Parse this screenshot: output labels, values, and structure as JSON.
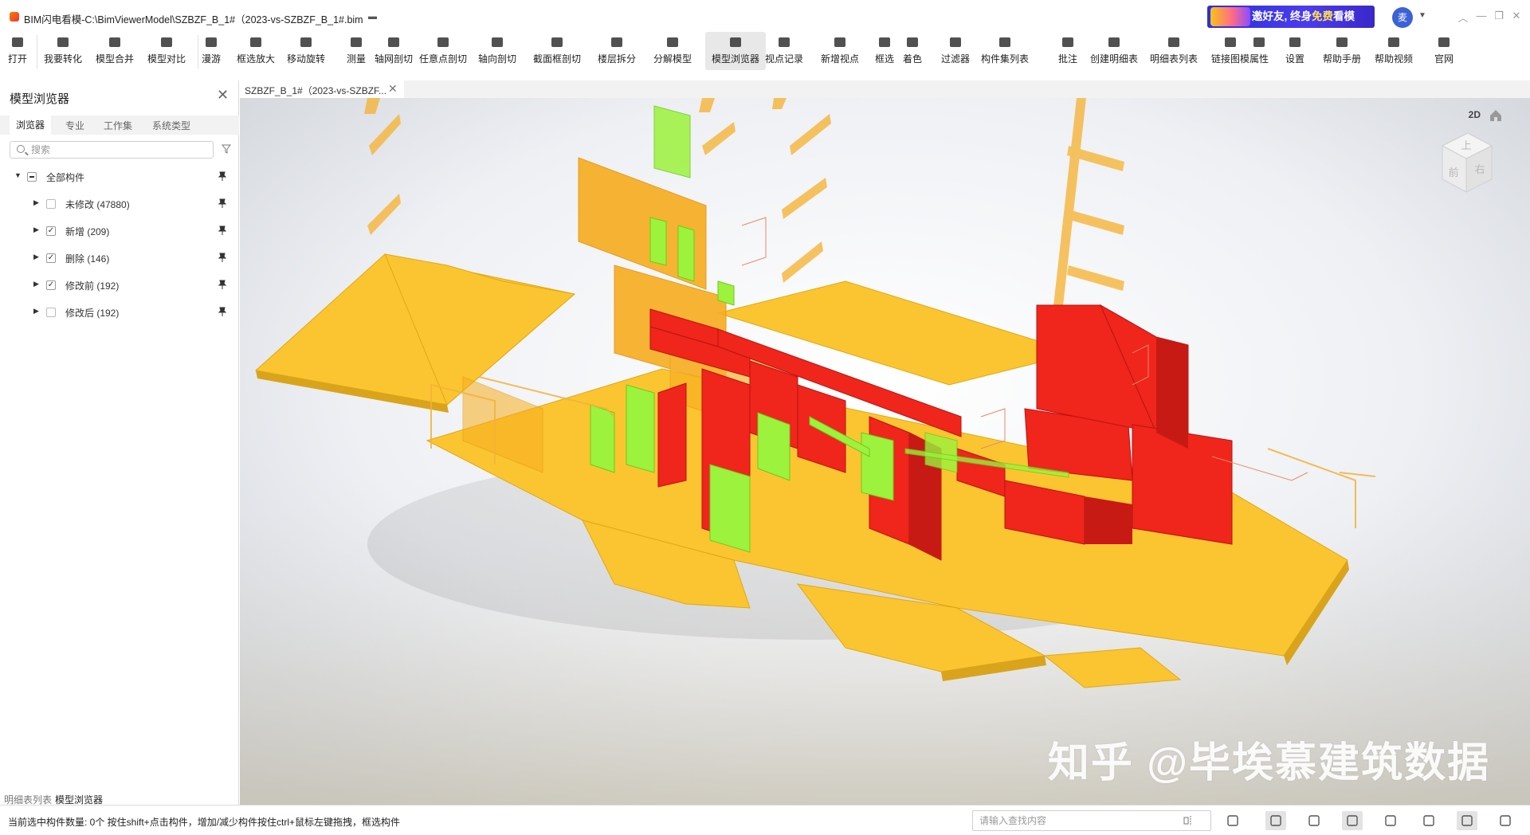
{
  "titlebar": {
    "title": "BIM闪电看模-C:\\BimViewerModel\\SZBZF_B_1#（2023-vs-SZBZF_B_1#.bim",
    "promo_prefix": "邀好友, 终身",
    "promo_highlight": "免费",
    "promo_suffix": "看模",
    "avatar_text": "麦",
    "window_controls": [
      "minimize",
      "restore",
      "maximize",
      "close"
    ]
  },
  "toolbar": {
    "items": [
      {
        "label": "打开",
        "icon": "folder-open-icon"
      },
      {
        "label": "我要转化",
        "icon": "convert-icon"
      },
      {
        "label": "模型合并",
        "icon": "merge-model-icon"
      },
      {
        "label": "模型对比",
        "icon": "compare-model-icon"
      },
      {
        "label": "漫游",
        "icon": "walk-icon"
      },
      {
        "label": "框选放大",
        "icon": "box-zoom-icon"
      },
      {
        "label": "移动旋转",
        "icon": "move-rotate-icon"
      },
      {
        "label": "测量",
        "icon": "ruler-icon"
      },
      {
        "label": "轴网剖切",
        "icon": "grid-section-icon"
      },
      {
        "label": "任意点剖切",
        "icon": "point-section-icon"
      },
      {
        "label": "轴向剖切",
        "icon": "axis-section-icon"
      },
      {
        "label": "截面框剖切",
        "icon": "section-box-icon"
      },
      {
        "label": "楼层拆分",
        "icon": "floor-split-icon"
      },
      {
        "label": "分解模型",
        "icon": "explode-model-icon"
      },
      {
        "label": "模型浏览器",
        "icon": "model-browser-icon"
      },
      {
        "label": "视点记录",
        "icon": "viewpoint-record-icon"
      },
      {
        "label": "新增视点",
        "icon": "add-viewpoint-icon"
      },
      {
        "label": "框选",
        "icon": "box-select-icon"
      },
      {
        "label": "着色",
        "icon": "paint-bucket-icon"
      },
      {
        "label": "过滤器",
        "icon": "filter-icon"
      },
      {
        "label": "构件集列表",
        "icon": "component-list-icon"
      },
      {
        "label": "批注",
        "icon": "annotate-icon"
      },
      {
        "label": "创建明细表",
        "icon": "create-schedule-icon"
      },
      {
        "label": "明细表列表",
        "icon": "schedule-list-icon"
      },
      {
        "label": "链接图模",
        "icon": "link-drawing-icon"
      },
      {
        "label": "属性",
        "icon": "info-icon"
      },
      {
        "label": "设置",
        "icon": "gear-icon"
      },
      {
        "label": "帮助手册",
        "icon": "help-manual-icon"
      },
      {
        "label": "帮助视频",
        "icon": "help-video-icon"
      },
      {
        "label": "官网",
        "icon": "website-icon"
      }
    ],
    "active_label": "模型浏览器"
  },
  "panel": {
    "title": "模型浏览器",
    "tabs": [
      "浏览器",
      "专业",
      "工作集",
      "系统类型"
    ],
    "active_tab": "浏览器",
    "search_placeholder": "搜索",
    "tree": [
      {
        "label": "全部构件",
        "state": "partial",
        "expanded": true,
        "level": 0
      },
      {
        "label": "未修改 (47880)",
        "state": "empty",
        "expanded": false,
        "level": 1
      },
      {
        "label": "新增 (209)",
        "state": "checked",
        "expanded": false,
        "level": 1
      },
      {
        "label": "删除 (146)",
        "state": "checked",
        "expanded": false,
        "level": 1
      },
      {
        "label": "修改前 (192)",
        "state": "checked",
        "expanded": false,
        "level": 1
      },
      {
        "label": "修改后 (192)",
        "state": "empty",
        "expanded": false,
        "level": 1
      }
    ],
    "footer_tabs": [
      "明细表列表",
      "模型浏览器"
    ]
  },
  "document_tab": {
    "label": "SZBZF_B_1#（2023-vs-SZBZF..."
  },
  "viewport": {
    "view_2d_label": "2D",
    "viewcube_top": "上",
    "viewcube_front": "前",
    "viewcube_right": "右",
    "watermark": "知乎 @毕埃慕建筑数据",
    "colors": {
      "unchanged": "#fbc531",
      "added": "#9cf23c",
      "deleted": "#f0251c",
      "modified": "#f2a61e"
    }
  },
  "statusbar": {
    "text": "当前选中构件数量: 0个 按住shift+点击构件，增加/减少构件按住ctrl+鼠标左键拖拽，框选构件",
    "search_placeholder": "请输入查找内容",
    "buttons": [
      "map-icon",
      "fit-view-icon",
      "layers-icon",
      "grid-icon",
      "info-icon",
      "hatch-icon",
      "edit-icon",
      "cube-icon"
    ]
  }
}
